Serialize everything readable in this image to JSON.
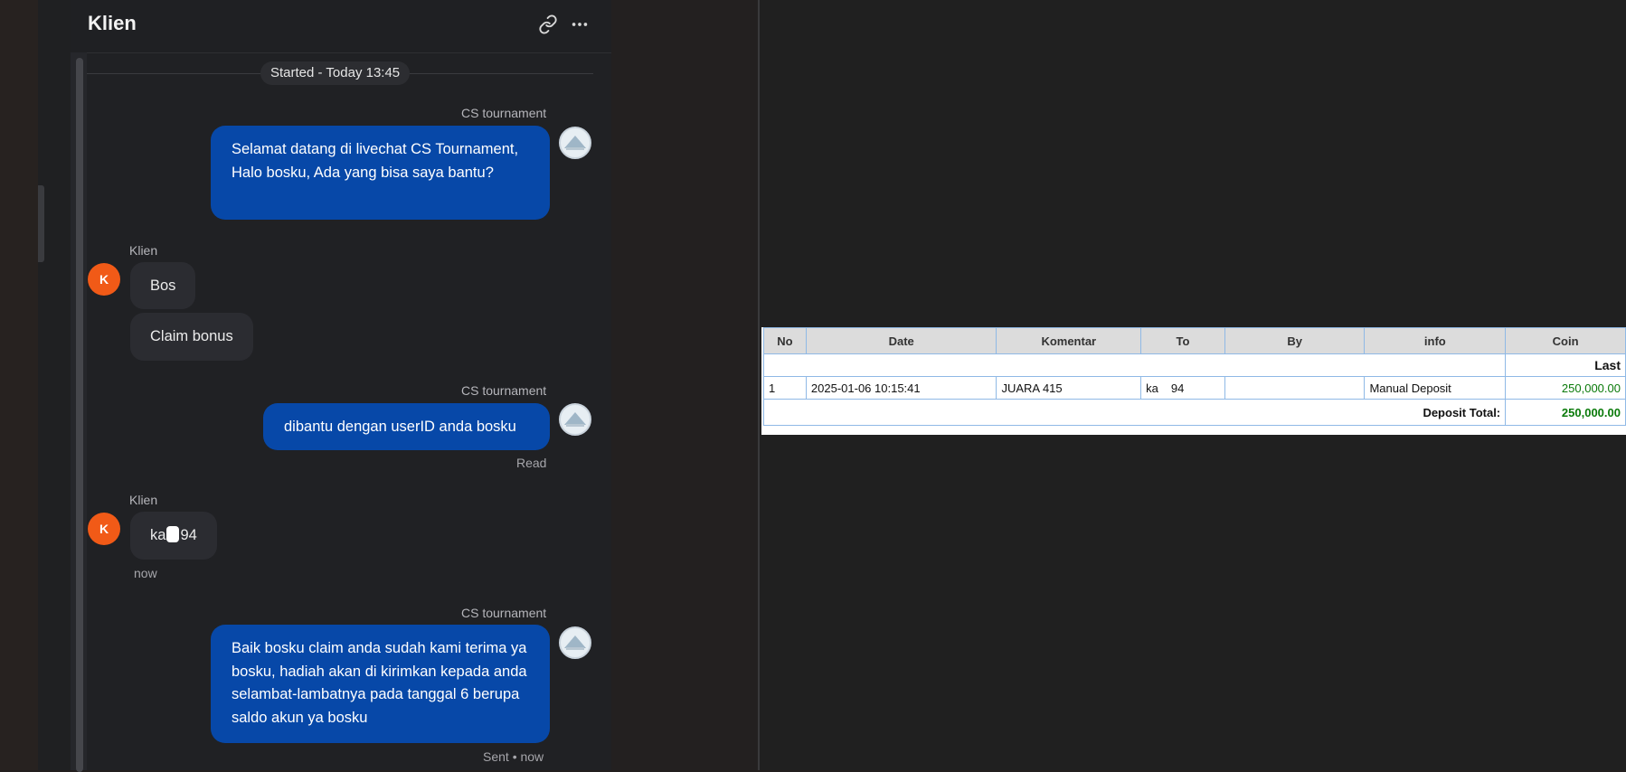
{
  "chat": {
    "title": "Klien",
    "started": "Started - Today 13:45",
    "messages": {
      "m1": {
        "sender": "CS tournament",
        "text": "Selamat datang di livechat CS Tournament, Halo bosku, Ada yang bisa saya bantu?"
      },
      "m2": {
        "sender": "Klien",
        "avatar": "K",
        "bubble1": "Bos",
        "bubble2": "Claim bonus"
      },
      "m3": {
        "sender": "CS tournament",
        "text": "dibantu dengan userID anda bosku",
        "status": "Read"
      },
      "m4": {
        "sender": "Klien",
        "avatar": "K",
        "text_prefix": "ka",
        "text_suffix": "94",
        "time": "now"
      },
      "m5": {
        "sender": "CS tournament",
        "text": "Baik bosku claim anda sudah kami terima ya bosku, hadiah akan di kirimkan kepada anda selambat-lambatnya pada tanggal 6 berupa saldo akun ya bosku",
        "status": "Sent • now"
      }
    },
    "icons": {
      "link": "link-icon",
      "more": "more-horizontal-icon"
    }
  },
  "report": {
    "columns": [
      "No",
      "Date",
      "Komentar",
      "To",
      "By",
      "info",
      "Coin"
    ],
    "last_label": "Last",
    "row": {
      "no": "1",
      "date": "2025-01-06 10:15:41",
      "komentar": "JUARA 415",
      "to_prefix": "ka",
      "to_suffix": "94",
      "by": "",
      "info": "Manual Deposit",
      "coin": "250,000.00"
    },
    "total_label": "Deposit Total:",
    "total_value": "250,000.00",
    "coin_color": "#0a7a0a"
  }
}
